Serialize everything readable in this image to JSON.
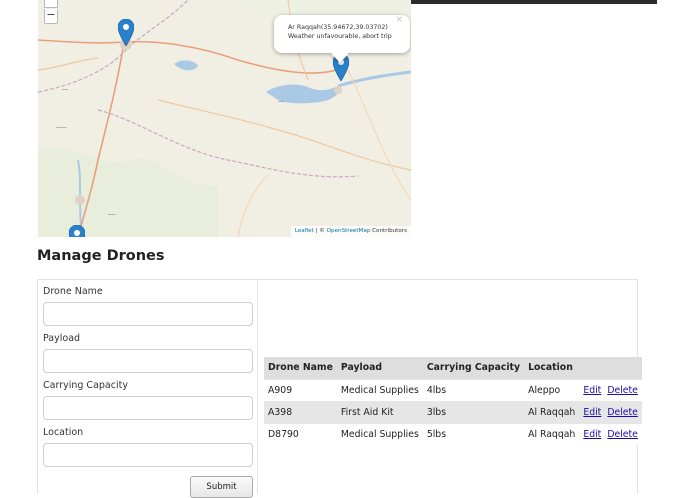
{
  "map": {
    "zoom_out_label": "−",
    "popup": {
      "coords": "Ar Raqqah(35.94672,39.03702)",
      "message": "Weather unfavourable, abort trip",
      "close": "×"
    },
    "attribution": {
      "leaflet": "Leaflet",
      "separator": " | © ",
      "osm": "OpenStreetMap",
      "contributors": " Contributors"
    },
    "marker_color": "#2a81cb"
  },
  "page": {
    "heading": "Manage Drones"
  },
  "form": {
    "fields": [
      {
        "label": "Drone Name",
        "value": ""
      },
      {
        "label": "Payload",
        "value": ""
      },
      {
        "label": "Carrying Capacity",
        "value": ""
      },
      {
        "label": "Location",
        "value": ""
      }
    ],
    "submit_label": "Submit"
  },
  "table": {
    "columns": [
      "Drone Name",
      "Payload",
      "Carrying Capacity",
      "Location",
      ""
    ],
    "rows": [
      {
        "name": "A909",
        "payload": "Medical Supplies",
        "capacity": "4lbs",
        "location": "Aleppo"
      },
      {
        "name": "A398",
        "payload": "First Aid Kit",
        "capacity": "3lbs",
        "location": "Al Raqqah"
      },
      {
        "name": "D8790",
        "payload": "Medical Supplies",
        "capacity": "5lbs",
        "location": "Al Raqqah"
      }
    ],
    "edit_label": "Edit",
    "delete_label": "Delete"
  }
}
